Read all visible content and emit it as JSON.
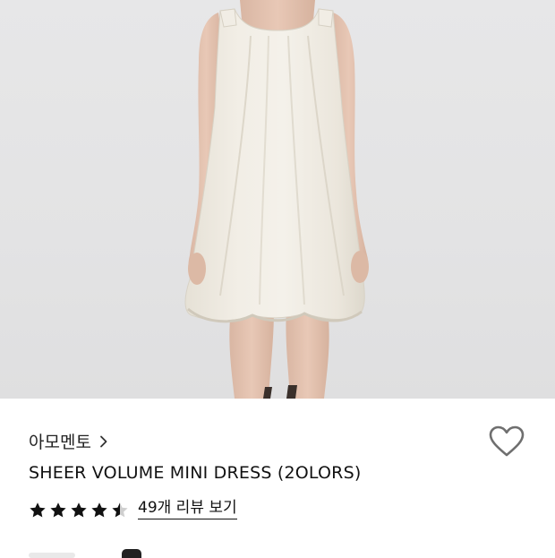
{
  "product": {
    "brand_label": "아모멘토",
    "title": "SHEER VOLUME MINI DRESS (2OLORS)",
    "image": {
      "subject": "model wearing a sleeveless ivory mini dress",
      "background_color": "#e4e4e5",
      "dress_color": "#efebe1"
    },
    "rating": {
      "stars_filled": 4.5,
      "stars_max": 5,
      "star_color": "#111111",
      "review_link_label": "49개 리뷰 보기"
    },
    "wishlist": {
      "icon": "heart-outline-icon",
      "active": false
    }
  },
  "icons": {
    "brand_chevron": "chevron-right-icon",
    "wishlist": "heart-icon",
    "rating": "star-icon"
  }
}
